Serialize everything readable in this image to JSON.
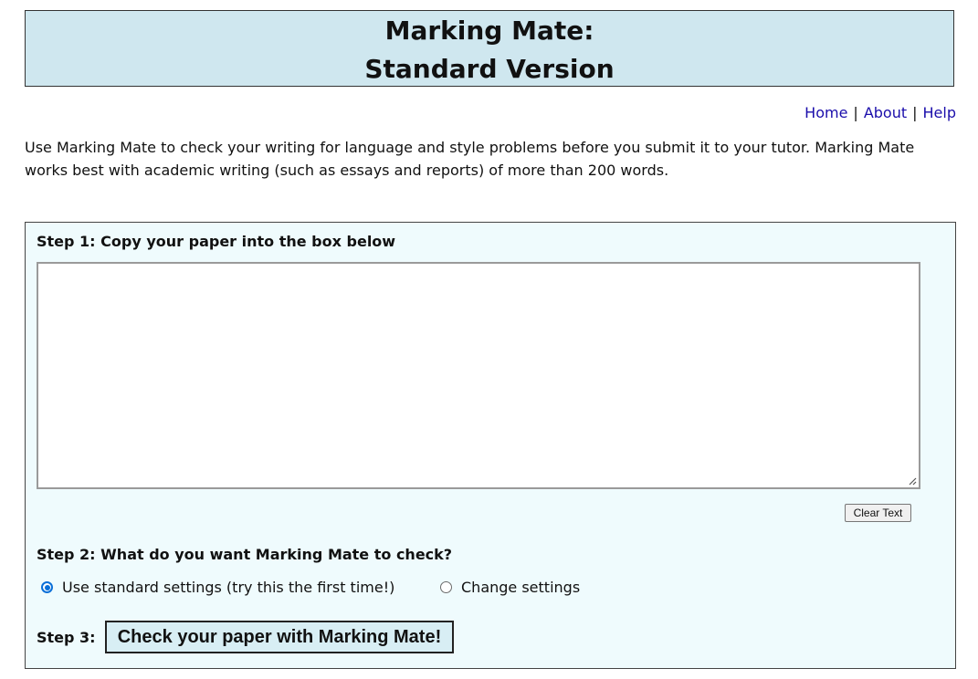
{
  "header": {
    "title_line1": "Marking Mate:",
    "title_line2": "Standard Version"
  },
  "nav": {
    "home": "Home",
    "about": "About",
    "help": "Help",
    "separator": "|"
  },
  "intro": "Use Marking Mate to check your writing for language and style problems before you submit it to your tutor. Marking Mate works best with academic writing (such as essays and reports) of more than 200 words.",
  "step1": {
    "label": "Step 1: Copy your paper into the box below",
    "textarea_value": "",
    "clear_button": "Clear Text"
  },
  "step2": {
    "label": "Step 2: What do you want Marking Mate to check?",
    "options": [
      {
        "label": "Use standard settings (try this the first time!)",
        "selected": true
      },
      {
        "label": "Change settings",
        "selected": false
      }
    ]
  },
  "step3": {
    "label": "Step 3:",
    "submit_button": "Check your paper with Marking Mate!"
  },
  "colors": {
    "header_bg": "#cfe7ef",
    "panel_bg": "#effbfd",
    "link": "#1a0dab",
    "radio_accent": "#0a6fd8"
  }
}
